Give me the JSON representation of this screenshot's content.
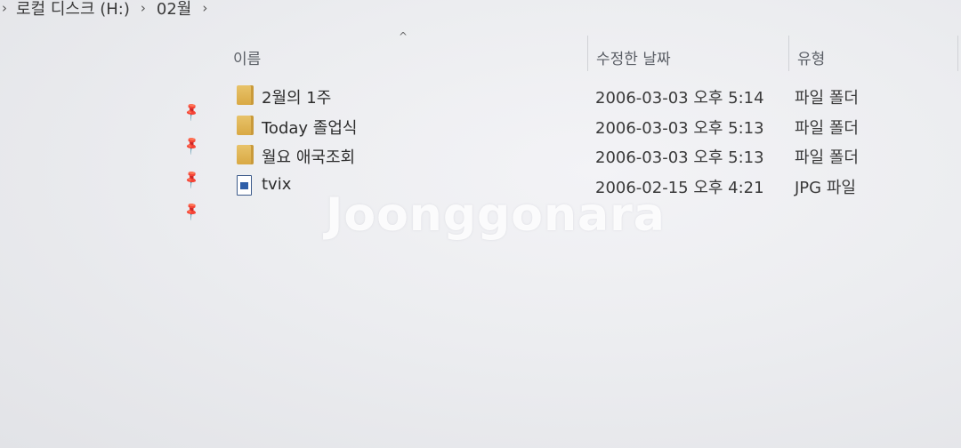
{
  "breadcrumb": {
    "items": [
      "로컬 디스크 (H:)",
      "02월"
    ],
    "separator": "›"
  },
  "columns": {
    "name": "이름",
    "date": "수정한 날짜",
    "type": "유형",
    "sort_indicator": "^"
  },
  "files": [
    {
      "name": "2월의 1주",
      "date": "2006-03-03 오후 5:14",
      "type": "파일 폴더",
      "icon": "folder-icon"
    },
    {
      "name": "Today 졸업식",
      "date": "2006-03-03 오후 5:13",
      "type": "파일 폴더",
      "icon": "folder-icon"
    },
    {
      "name": "월요 애국조회",
      "date": "2006-03-03 오후 5:13",
      "type": "파일 폴더",
      "icon": "folder-icon"
    },
    {
      "name": "tvix",
      "date": "2006-02-15 오후 4:21",
      "type": "JPG 파일",
      "icon": "jpg-file-icon"
    }
  ],
  "pins": {
    "icon": "pin-icon",
    "glyph": "📌"
  },
  "watermark": "Joonggonara",
  "colors": {
    "folder": "#e2b655",
    "header_text": "#5b5f66",
    "background": "#ecedf0"
  }
}
